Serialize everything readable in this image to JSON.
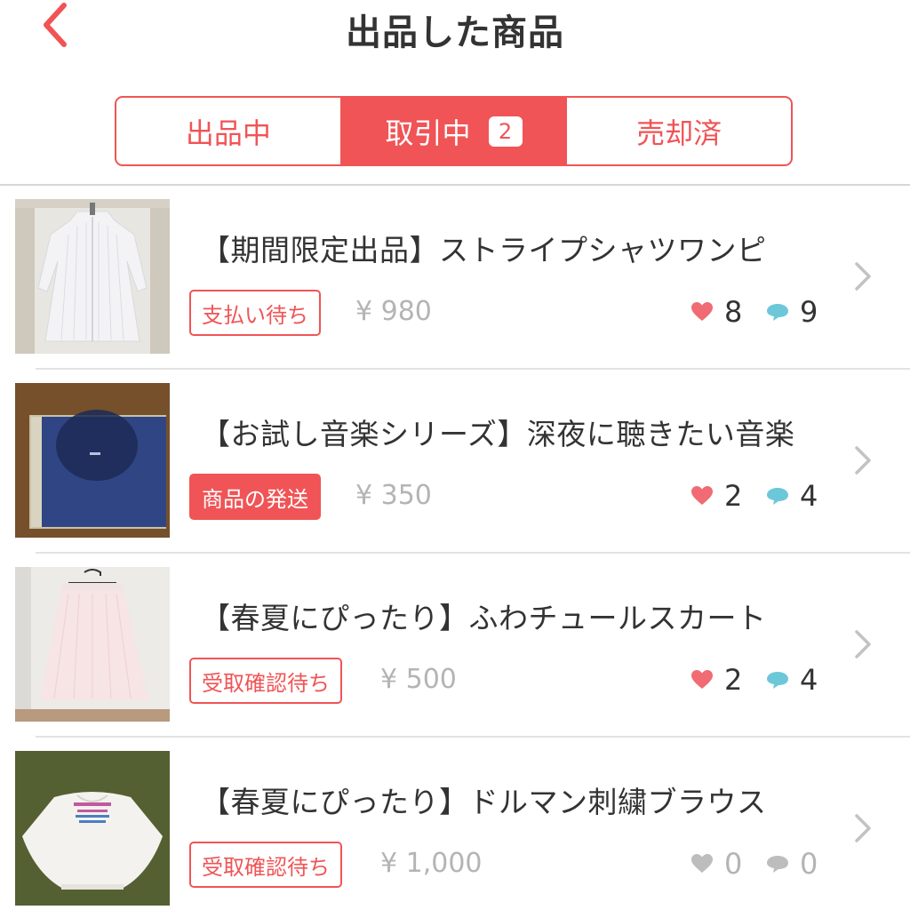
{
  "header": {
    "title": "出品した商品"
  },
  "tabs": [
    {
      "label": "出品中",
      "badge": ""
    },
    {
      "label": "取引中",
      "badge": "2"
    },
    {
      "label": "売却済",
      "badge": ""
    }
  ],
  "colors": {
    "accent": "#f05456",
    "like_active": "#f06b73",
    "comment_active": "#6cc8d8",
    "inactive_icon": "#bdbdbd"
  },
  "items": [
    {
      "title": "【期間限定出品】ストライプシャツワンピ",
      "status": "支払い待ち",
      "status_style": "outline",
      "price": "¥ 980",
      "likes": "8",
      "comments": "9",
      "thumb": "striped-shirt-dress-photo"
    },
    {
      "title": "【お試し音楽シリーズ】深夜に聴きたい音楽",
      "status": "商品の発送",
      "status_style": "filled",
      "price": "¥ 350",
      "likes": "2",
      "comments": "4",
      "thumb": "music-cd-case-photo"
    },
    {
      "title": "【春夏にぴったり】ふわチュールスカート",
      "status": "受取確認待ち",
      "status_style": "outline",
      "price": "¥ 500",
      "likes": "2",
      "comments": "4",
      "thumb": "tulle-skirt-photo"
    },
    {
      "title": "【春夏にぴったり】ドルマン刺繍ブラウス",
      "status": "受取確認待ち",
      "status_style": "outline",
      "price": "¥ 1,000",
      "likes": "0",
      "comments": "0",
      "thumb": "dolman-blouse-photo"
    }
  ]
}
